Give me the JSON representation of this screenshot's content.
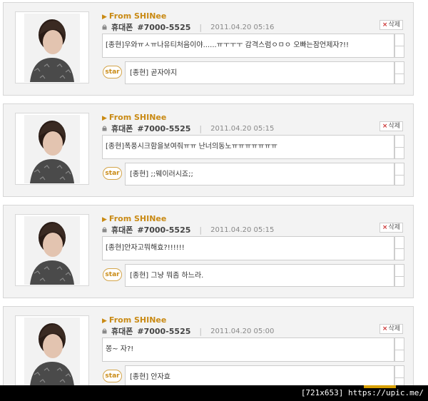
{
  "cards": [
    {
      "from": "From SHINee",
      "phone_label": "휴대폰",
      "phone_number": "#7000-5525",
      "timestamp": "2011.04.20 05:16",
      "delete_label": "삭제",
      "message": "[종현]우와ㅠㅅㅠ나유티처음이야......ㅠㅜㅜㅜ 감격스럼ㅇㅁㅇ 오빠는잠언제자?!!",
      "star_label": "star",
      "reply": "[종현] 곧자야지"
    },
    {
      "from": "From SHINee",
      "phone_label": "휴대폰",
      "phone_number": "#7000-5525",
      "timestamp": "2011.04.20 05:15",
      "delete_label": "삭제",
      "message": "[종현]폭풍시크함을보여줘ㅠㅠ 난너의동노ㅠㅠㅠㅠㅠㅠㅠ",
      "star_label": "star",
      "reply": "[종현] ;;웨이러시죠;;"
    },
    {
      "from": "From SHINee",
      "phone_label": "휴대폰",
      "phone_number": "#7000-5525",
      "timestamp": "2011.04.20 05:15",
      "delete_label": "삭제",
      "message": "[종현]안자고뭐해효?!!!!!!",
      "star_label": "star",
      "reply": "[종현] 그냥 뭐좀 하느라."
    },
    {
      "from": "From SHINee",
      "phone_label": "휴대폰",
      "phone_number": "#7000-5525",
      "timestamp": "2011.04.20 05:00",
      "delete_label": "삭제",
      "message": "쫑~ 자?!",
      "star_label": "star",
      "reply": "[종현] 안자효"
    }
  ],
  "watermark": "[721x653] https://upic.me/",
  "colors": {
    "accent": "#c98a14",
    "card_bg": "#f3f3f3",
    "border": "#cdcdcd"
  },
  "icons": {
    "lock": "lock-icon",
    "arrow": "arrow-right-icon",
    "delete": "close-icon"
  }
}
